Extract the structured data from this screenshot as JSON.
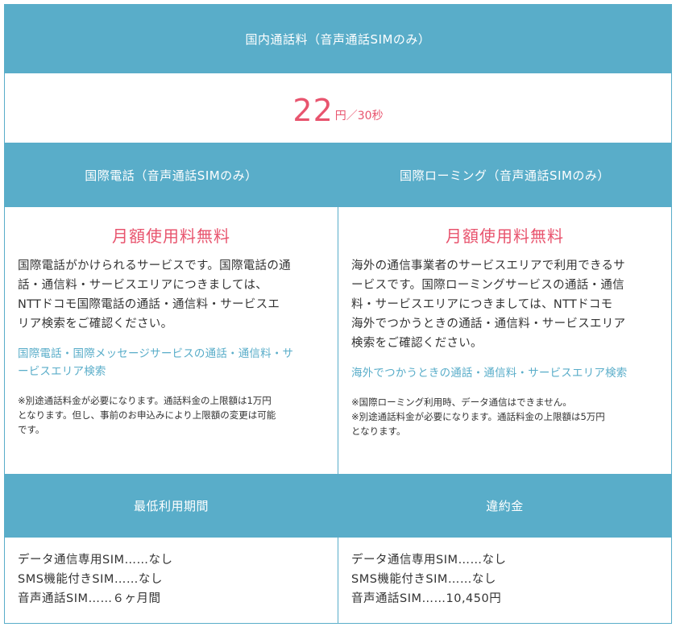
{
  "colors": {
    "accent": "#59adc9",
    "highlight": "#e8546e"
  },
  "domestic": {
    "header": "国内通話料（音声通話SIMのみ）",
    "price_value": "22",
    "price_unit": "円／30秒"
  },
  "intl_call": {
    "header": "国際電話（音声通話SIMのみ）",
    "free_label": "月額使用料無料",
    "description": [
      "国際電話がかけられるサービスです。国際電話の通",
      "話・通信料・サービスエリアにつきましては、",
      "NTTドコモ国際電話の通話・通信料・サービスエ",
      "リア検索をご確認ください。"
    ],
    "link": [
      "国際電話・国際メッセージサービスの通話・通信料・サ",
      "ービスエリア検索"
    ],
    "notes": [
      "※別途通話料金が必要になります。通話料金の上限額は1万円",
      "となります。但し、事前のお申込みにより上限額の変更は可能",
      "です。"
    ]
  },
  "intl_roaming": {
    "header": "国際ローミング（音声通話SIMのみ）",
    "free_label": "月額使用料無料",
    "description": [
      "海外の通信事業者のサービスエリアで利用できるサ",
      "ービスです。国際ローミングサービスの通話・通信",
      "料・サービスエリアにつきましては、NTTドコモ",
      "海外でつかうときの通話・通信料・サービスエリア",
      "検索をご確認ください。"
    ],
    "link": [
      "海外でつかうときの通話・通信料・サービスエリア検索"
    ],
    "notes": [
      "※国際ローミング利用時、データ通信はできません。",
      "※別途通話料金が必要になります。通話料金の上限額は5万円",
      "となります。"
    ]
  },
  "min_period": {
    "header": "最低利用期間",
    "lines": [
      "データ通信専用SIM……なし",
      "SMS機能付きSIM……なし",
      "音声通話SIM……６ヶ月間"
    ]
  },
  "penalty": {
    "header": "違約金",
    "lines": [
      "データ通信専用SIM……なし",
      "SMS機能付きSIM……なし",
      "音声通話SIM……10,450円"
    ]
  }
}
